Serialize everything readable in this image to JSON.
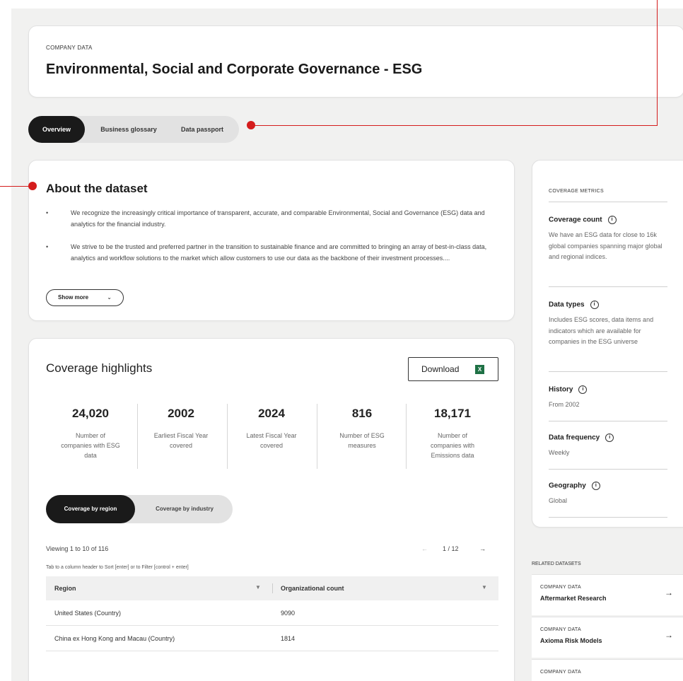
{
  "header": {
    "eyebrow": "COMPANY DATA",
    "title": "Environmental, Social and Corporate Governance - ESG"
  },
  "tabs": [
    {
      "label": "Overview",
      "active": true
    },
    {
      "label": "Business glossary",
      "active": false
    },
    {
      "label": "Data passport",
      "active": false
    }
  ],
  "about": {
    "title": "About the dataset",
    "bullets": [
      "We recognize the increasingly critical importance of transparent, accurate, and comparable Environmental, Social and Governance (ESG) data and analytics for the financial industry.",
      "We strive to be the trusted and preferred partner in the transition to sustainable finance and are committed to bringing an array of best-in-class data, analytics and workflow solutions to the market which allow customers to use our data as the backbone of their investment processes...."
    ],
    "show_more": "Show more",
    "show_more_icon": "chevron-down-icon"
  },
  "coverage": {
    "title": "Coverage highlights",
    "download_label": "Download",
    "download_icon": "excel-icon",
    "stats": [
      {
        "value": "24,020",
        "label": "Number of companies with ESG data"
      },
      {
        "value": "2002",
        "label": "Earliest Fiscal Year covered"
      },
      {
        "value": "2024",
        "label": "Latest Fiscal Year covered"
      },
      {
        "value": "816",
        "label": "Number of ESG measures"
      },
      {
        "value": "18,171",
        "label": "Number of companies with Emissions data"
      }
    ],
    "subtabs": [
      {
        "label": "Coverage by region",
        "active": true
      },
      {
        "label": "Coverage by industry",
        "active": false
      }
    ],
    "viewing": "Viewing 1 to 10 of 116",
    "pager": {
      "prev": "←",
      "page": "1 / 12",
      "next": "→"
    },
    "hint": "Tab to a column header to Sort [enter] or to Filter [control + enter]",
    "table": {
      "columns": [
        "Region",
        "Organizational count"
      ],
      "rows": [
        [
          "United States (Country)",
          "9090"
        ],
        [
          "China ex Hong Kong and Macau (Country)",
          "1814"
        ]
      ]
    }
  },
  "metrics": {
    "eyebrow": "COVERAGE METRICS",
    "items": [
      {
        "title": "Coverage count",
        "desc": "We have an ESG data for close to 16k global companies spanning major global and regional indices."
      },
      {
        "title": "Data types",
        "desc": "Includes ESG scores, data items and indicators which are available for companies in the ESG universe"
      },
      {
        "title": "History",
        "desc": "From 2002"
      },
      {
        "title": "Data frequency",
        "desc": "Weekly"
      },
      {
        "title": "Geography",
        "desc": "Global"
      }
    ]
  },
  "related": {
    "title": "RELATED DATASETS",
    "items": [
      {
        "eyebrow": "COMPANY DATA",
        "name": "Aftermarket Research"
      },
      {
        "eyebrow": "COMPANY DATA",
        "name": "Axioma Risk Models"
      },
      {
        "eyebrow": "COMPANY DATA",
        "name": ""
      }
    ]
  },
  "colors": {
    "callout": "#d41c1c",
    "active_tab": "#1a1a1a",
    "excel": "#1e7145"
  }
}
